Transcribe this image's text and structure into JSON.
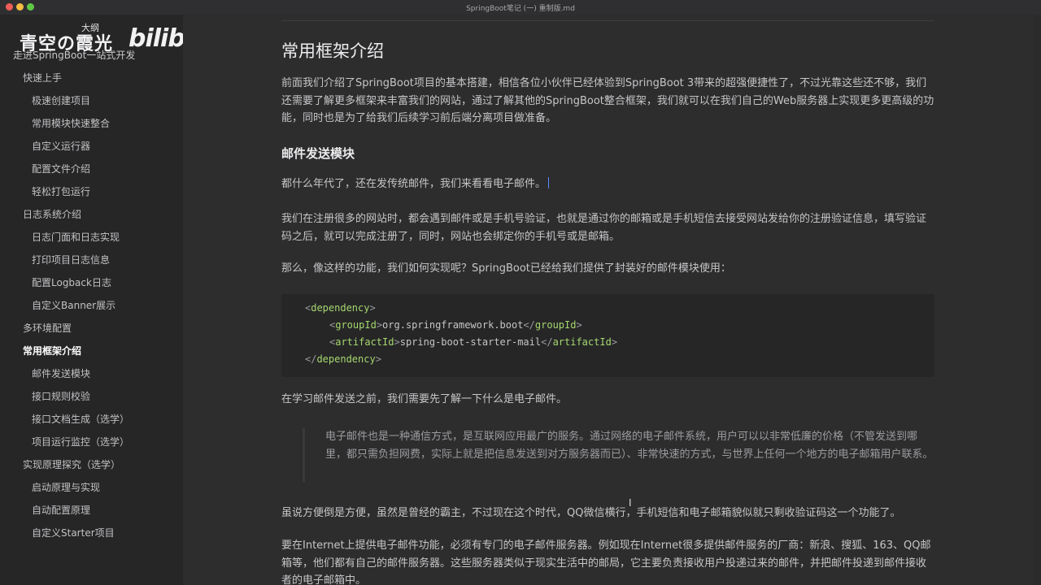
{
  "window": {
    "title": "SpringBoot笔记 (一) 重制版.md"
  },
  "overlay": {
    "outline_label": "大纲",
    "channel_name": "青空の霞光",
    "logo_text": "bilibili"
  },
  "outline": {
    "items": [
      {
        "label": "走进SpringBoot一站式开发",
        "level": "top"
      },
      {
        "label": "快速上手",
        "level": 0
      },
      {
        "label": "极速创建项目",
        "level": 1
      },
      {
        "label": "常用模块快速整合",
        "level": 1
      },
      {
        "label": "自定义运行器",
        "level": 1
      },
      {
        "label": "配置文件介绍",
        "level": 1
      },
      {
        "label": "轻松打包运行",
        "level": 1
      },
      {
        "label": "日志系统介绍",
        "level": 0
      },
      {
        "label": "日志门面和日志实现",
        "level": 1
      },
      {
        "label": "打印项目日志信息",
        "level": 1
      },
      {
        "label": "配置Logback日志",
        "level": 1
      },
      {
        "label": "自定义Banner展示",
        "level": 1
      },
      {
        "label": "多环境配置",
        "level": 0
      },
      {
        "label": "常用框架介绍",
        "level": 0,
        "active": true
      },
      {
        "label": "邮件发送模块",
        "level": 1
      },
      {
        "label": "接口规则校验",
        "level": 1
      },
      {
        "label": "接口文档生成（选学）",
        "level": 1
      },
      {
        "label": "项目运行监控（选学）",
        "level": 1
      },
      {
        "label": "实现原理探究（选学）",
        "level": 0
      },
      {
        "label": "启动原理与实现",
        "level": 1
      },
      {
        "label": "自动配置原理",
        "level": 1
      },
      {
        "label": "自定义Starter项目",
        "level": 1
      }
    ]
  },
  "document": {
    "h2": "常用框架介绍",
    "intro": "前面我们介绍了SpringBoot项目的基本搭建，相信各位小伙伴已经体验到SpringBoot 3带来的超强便捷性了，不过光靠这些还不够，我们还需要了解更多框架来丰富我们的网站，通过了解其他的SpringBoot整合框架，我们就可以在我们自己的Web服务器上实现更多更高级的功能，同时也是为了给我们后续学习前后端分离项目做准备。",
    "h3": "邮件发送模块",
    "p1": "都什么年代了，还在发传统邮件，我们来看看电子邮件。",
    "p2": "我们在注册很多的网站时，都会遇到邮件或是手机号验证，也就是通过你的邮箱或是手机短信去接受网站发给你的注册验证信息，填写验证码之后，就可以完成注册了，同时，网站也会绑定你的手机号或是邮箱。",
    "p3": "那么，像这样的功能，我们如何实现呢？SpringBoot已经给我们提供了封装好的邮件模块使用：",
    "code": {
      "dependency_tag": "dependency",
      "group_tag": "groupId",
      "group_value": "org.springframework.boot",
      "artifact_tag": "artifactId",
      "artifact_value": "spring-boot-starter-mail"
    },
    "p4": "在学习邮件发送之前，我们需要先了解一下什么是电子邮件。",
    "quote": "电子邮件也是一种通信方式，是互联网应用最广的服务。通过网络的电子邮件系统，用户可以以非常低廉的价格（不管发送到哪里，都只需负担网费，实际上就是把信息发送到对方服务器而已）、非常快速的方式，与世界上任何一个地方的电子邮箱用户联系。",
    "p5": "虽说方便倒是方便，虽然是曾经的霸主，不过现在这个时代，QQ微信横行，手机短信和电子邮箱貌似就只剩收验证码这一个功能了。",
    "p6": "要在Internet上提供电子邮件功能，必须有专门的电子邮件服务器。例如现在Internet很多提供邮件服务的厂商：新浪、搜狐、163、QQ邮箱等，他们都有自己的邮件服务器。这些服务器类似于现实生活中的邮局，它主要负责接收用户投递过来的邮件，并把邮件投递到邮件接收者的电子邮箱中。"
  }
}
